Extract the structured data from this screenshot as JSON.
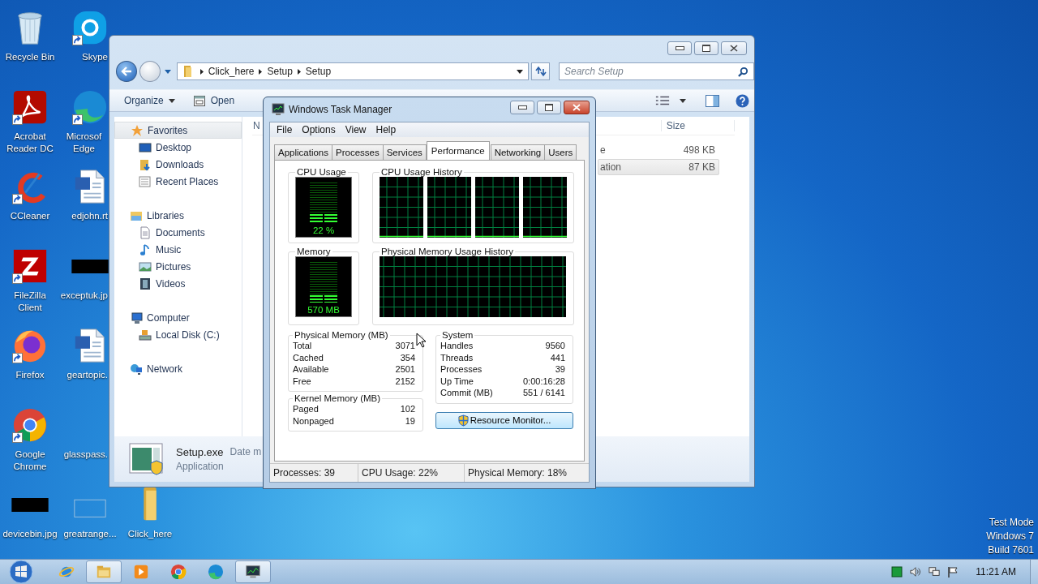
{
  "desktop_icons": [
    {
      "label": "Recycle Bin",
      "kind": "recycle",
      "shortcut": false
    },
    {
      "label": "Acrobat Reader DC",
      "kind": "acrobat",
      "shortcut": true
    },
    {
      "label": "CCleaner",
      "kind": "ccleaner",
      "shortcut": true
    },
    {
      "label": "FileZilla Client",
      "kind": "filezilla",
      "shortcut": true
    },
    {
      "label": "Firefox",
      "kind": "firefox",
      "shortcut": true
    },
    {
      "label": "Google Chrome",
      "kind": "chrome",
      "shortcut": true
    },
    {
      "label": "devicebin.jpg",
      "kind": "blackbox",
      "shortcut": false
    },
    {
      "label": "Skype",
      "kind": "skype",
      "shortcut": true
    },
    {
      "label": "Microsof Edge",
      "kind": "edge",
      "shortcut": true
    },
    {
      "label": "edjohn.rt",
      "kind": "word",
      "shortcut": false
    },
    {
      "label": "exceptuk.jp",
      "kind": "blackbox",
      "shortcut": false
    },
    {
      "label": "geartopic.",
      "kind": "word",
      "shortcut": false
    },
    {
      "label": "glasspass.",
      "kind": "none",
      "shortcut": false
    },
    {
      "label": "greatrange...",
      "kind": "blank",
      "shortcut": false
    },
    {
      "label": "Click_here",
      "kind": "folder",
      "shortcut": false
    }
  ],
  "explorer": {
    "breadcrumb": [
      "Click_here",
      "Setup",
      "Setup"
    ],
    "search": {
      "placeholder": "Search Setup"
    },
    "toolbar": [
      {
        "label": "Organize",
        "kind": "menu"
      },
      {
        "label": "Open",
        "kind": "open"
      }
    ],
    "nav": [
      {
        "label": "Favorites",
        "kind": "star",
        "selected": true,
        "children": [
          {
            "label": "Desktop",
            "kind": "desktop",
            "selected": false
          },
          {
            "label": "Downloads",
            "kind": "downloads",
            "selected": false
          },
          {
            "label": "Recent Places",
            "kind": "recent",
            "selected": false
          }
        ]
      },
      {
        "label": "Libraries",
        "kind": "libraries",
        "selected": false,
        "children": [
          {
            "label": "Documents",
            "kind": "documents",
            "selected": false
          },
          {
            "label": "Music",
            "kind": "music",
            "selected": false
          },
          {
            "label": "Pictures",
            "kind": "pictures",
            "selected": false
          },
          {
            "label": "Videos",
            "kind": "videos",
            "selected": false
          }
        ]
      },
      {
        "label": "Computer",
        "kind": "computer",
        "selected": false,
        "children": [
          {
            "label": "Local Disk (C:)",
            "kind": "disk",
            "selected": false
          }
        ]
      },
      {
        "label": "Network",
        "kind": "network",
        "selected": false
      }
    ],
    "file_list": {
      "columns": [
        "N",
        "Size"
      ],
      "rows": [
        {
          "column_1": "e",
          "size": "498 KB",
          "selected": false
        },
        {
          "column_1": "ation",
          "size": "87 KB",
          "selected": true
        }
      ]
    },
    "details": {
      "name": "Setup.exe",
      "label_1": "Date m",
      "type": "Application"
    }
  },
  "task_manager": {
    "title": "Windows Task Manager",
    "menu": [
      "File",
      "Options",
      "View",
      "Help"
    ],
    "tabs": [
      {
        "label": "Applications",
        "selected": false
      },
      {
        "label": "Processes",
        "selected": false
      },
      {
        "label": "Services",
        "selected": false
      },
      {
        "label": "Performance",
        "selected": true
      },
      {
        "label": "Networking",
        "selected": false
      },
      {
        "label": "Users",
        "selected": false
      }
    ],
    "cpu_usage": {
      "title": "CPU Usage",
      "reading": "22 %",
      "level": 0.22
    },
    "cpu_history": {
      "title": "CPU Usage History"
    },
    "memory": {
      "title": "Memory",
      "reading": "570 MB",
      "level": 0.18
    },
    "memory_history": {
      "title": "Physical Memory Usage History"
    },
    "physical_memory": {
      "title": "Physical Memory (MB)",
      "rows": [
        {
          "label": "Total",
          "value": "3071"
        },
        {
          "label": "Cached",
          "value": "354"
        },
        {
          "label": "Available",
          "value": "2501"
        },
        {
          "label": "Free",
          "value": "2152"
        }
      ]
    },
    "kernel_memory": {
      "title": "Kernel Memory (MB)",
      "rows": [
        {
          "label": "Paged",
          "value": "102"
        },
        {
          "label": "Nonpaged",
          "value": "19"
        }
      ]
    },
    "system": {
      "title": "System",
      "rows": [
        {
          "label": "Handles",
          "value": "9560"
        },
        {
          "label": "Threads",
          "value": "441"
        },
        {
          "label": "Processes",
          "value": "39"
        },
        {
          "label": "Up Time",
          "value": "0:00:16:28"
        },
        {
          "label": "Commit (MB)",
          "value": "551 / 6141"
        }
      ]
    },
    "resource_monitor_button": "Resource Monitor...",
    "status_bar": [
      "Processes: 39",
      "CPU Usage: 22%",
      "Physical Memory: 18%"
    ]
  },
  "system_notice": [
    "Test Mode",
    "Windows 7",
    "Build 7601"
  ],
  "taskbar": {
    "items": [
      {
        "kind": "ie",
        "selected": false
      },
      {
        "kind": "explorer",
        "selected": true
      },
      {
        "kind": "media",
        "selected": false
      },
      {
        "kind": "chrome",
        "selected": false
      },
      {
        "kind": "edge",
        "selected": false
      },
      {
        "kind": "taskmgr",
        "selected": true
      }
    ],
    "time": "11:21 AM"
  }
}
